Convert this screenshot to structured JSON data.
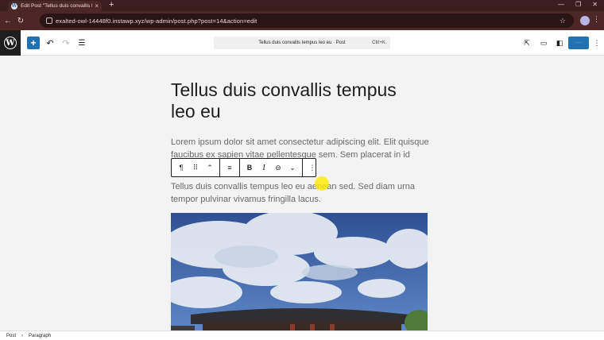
{
  "browser": {
    "tab_title": "Edit Post \"Tellus duis convallis te...",
    "tab_close": "×",
    "new_tab": "+",
    "window_controls": [
      "—",
      "❐",
      "✕"
    ],
    "url": "exalted-owl-14448f0.instawp.xyz/wp-admin/post.php?post=14&action=edit"
  },
  "toolbar": {
    "inserter_label": "+",
    "document_title": "Tellus duis convallis tempus leo eu · Post",
    "shortcut": "Ctrl+K",
    "save_label": "····"
  },
  "post": {
    "title": "Tellus duis convallis tempus leo eu",
    "paragraphs": [
      "Lorem ipsum dolor sit amet consectetur adipiscing elit. Elit quisque faucibus ex sapien vitae pellentesque sem. Sem placerat in id",
      "Tellus duis convallis tempus leo eu aenean sed. Sed diam urna tempor pulvinar vivamus fringilla lacus."
    ]
  },
  "block_toolbar": {
    "paragraph_icon": "¶",
    "drag_icon": "⠿",
    "mover_icon": "⌃",
    "align_icon": "≡",
    "bold": "B",
    "italic": "I",
    "link_icon": "⊖",
    "more_icon": "⌄",
    "options_icon": "⋮"
  },
  "footer": {
    "breadcrumb": [
      "Post",
      "Paragraph"
    ]
  },
  "colors": {
    "accent": "#2271b1",
    "browser_chrome": "#4d2626",
    "canvas": "#f3f3f3"
  }
}
